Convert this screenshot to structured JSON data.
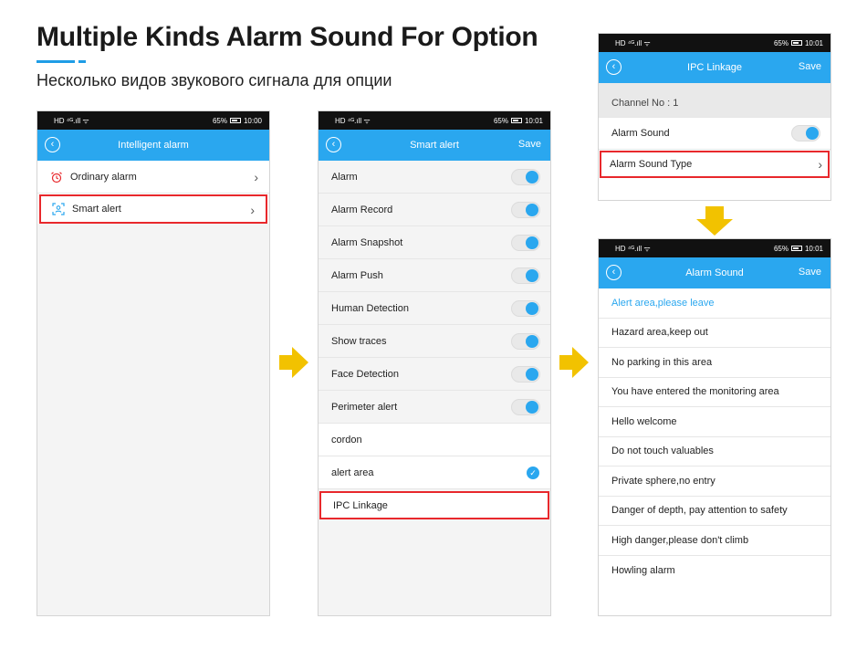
{
  "header": {
    "title": "Multiple Kinds Alarm Sound For Option",
    "subtitle": "Несколько видов звукового сигнала для опции"
  },
  "colors": {
    "accent": "#2aa7ef",
    "highlight": "#e8282c",
    "arrow": "#f2c200"
  },
  "phone1": {
    "status": {
      "left": "HD ⁴ᴳ.ıll ᯤ",
      "battery": "65%",
      "time": "10:00"
    },
    "title": "Intelligent alarm",
    "items": [
      {
        "label": "Ordinary alarm",
        "icon": "alarm-clock-icon"
      },
      {
        "label": "Smart alert",
        "icon": "face-scan-icon",
        "highlighted": true
      }
    ]
  },
  "phone2": {
    "status": {
      "left": "HD ⁴ᴳ.ıll ᯤ",
      "battery": "65%",
      "time": "10:01"
    },
    "title": "Smart alert",
    "save": "Save",
    "items": [
      {
        "label": "Alarm",
        "control": "toggle-on"
      },
      {
        "label": "Alarm Record",
        "control": "toggle-on"
      },
      {
        "label": "Alarm Snapshot",
        "control": "toggle-on"
      },
      {
        "label": "Alarm Push",
        "control": "toggle-on"
      },
      {
        "label": "Human Detection",
        "control": "toggle-on"
      },
      {
        "label": "Show traces",
        "control": "toggle-on"
      },
      {
        "label": "Face Detection",
        "control": "toggle-on"
      },
      {
        "label": "Perimeter alert",
        "control": "toggle-on"
      },
      {
        "label": "cordon",
        "control": "none"
      },
      {
        "label": "alert area",
        "control": "checked"
      },
      {
        "label": "IPC Linkage",
        "control": "none",
        "highlighted": true
      }
    ]
  },
  "phone3": {
    "status": {
      "left": "HD ⁴ᴳ.ıll ᯤ",
      "battery": "65%",
      "time": "10:01"
    },
    "title": "IPC Linkage",
    "save": "Save",
    "channel": "Channel No : 1",
    "alarm_sound": "Alarm Sound",
    "alarm_sound_type": "Alarm Sound Type"
  },
  "phone4": {
    "status": {
      "left": "HD ⁴ᴳ.ıll ᯤ",
      "battery": "65%",
      "time": "10:01"
    },
    "title": "Alarm Sound",
    "save": "Save",
    "items": [
      "Alert area,please leave",
      "Hazard area,keep out",
      "No parking in this area",
      "You have entered the monitoring area",
      "Hello welcome",
      "Do not touch valuables",
      "Private sphere,no entry",
      "Danger of depth, pay attention to safety",
      "High danger,please don't climb",
      "Howling alarm"
    ],
    "selected_index": 0
  }
}
